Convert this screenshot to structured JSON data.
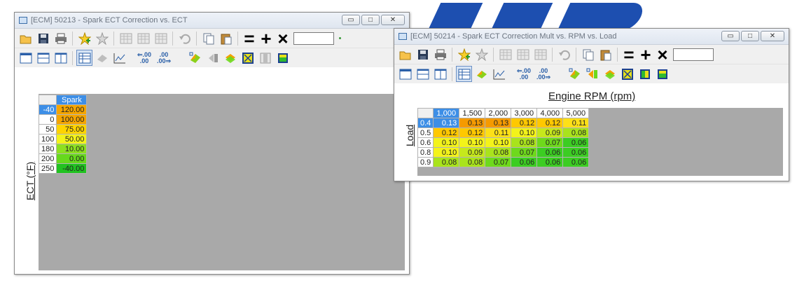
{
  "win1": {
    "title": "[ECM] 50213 - Spark ECT Correction vs. ECT",
    "value_input": "",
    "y_axis_label": "ECT (°F)",
    "column_header": "Spark",
    "rows": [
      {
        "label": "-40",
        "value": "120.00",
        "color": "#f5a500"
      },
      {
        "label": "0",
        "value": "100.00",
        "color": "#f5a500"
      },
      {
        "label": "50",
        "value": "75.00",
        "color": "#ffd400"
      },
      {
        "label": "100",
        "value": "50.00",
        "color": "#f3f31a"
      },
      {
        "label": "180",
        "value": "10.00",
        "color": "#8de020"
      },
      {
        "label": "200",
        "value": "0.00",
        "color": "#66d91c"
      },
      {
        "label": "250",
        "value": "-40.00",
        "color": "#21c221"
      }
    ]
  },
  "win2": {
    "title": "[ECM] 50214 - Spark ECT Correction Mult vs. RPM vs. Load",
    "value_input": "",
    "x_axis_label": "Engine RPM (rpm)",
    "y_axis_label": "Load",
    "columns": [
      "1,000",
      "1,500",
      "2,000",
      "3,000",
      "4,000",
      "5,000"
    ],
    "rows": [
      {
        "label": "0.4",
        "cells": [
          {
            "v": "0.13",
            "c": "#f59a00"
          },
          {
            "v": "0.13",
            "c": "#f59a00"
          },
          {
            "v": "0.13",
            "c": "#f59a00"
          },
          {
            "v": "0.12",
            "c": "#ffc800"
          },
          {
            "v": "0.12",
            "c": "#ffc800"
          },
          {
            "v": "0.11",
            "c": "#fde018"
          }
        ]
      },
      {
        "label": "0.5",
        "cells": [
          {
            "v": "0.12",
            "c": "#ffc800"
          },
          {
            "v": "0.12",
            "c": "#ffc800"
          },
          {
            "v": "0.11",
            "c": "#fde018"
          },
          {
            "v": "0.10",
            "c": "#f3f31a"
          },
          {
            "v": "0.09",
            "c": "#c6e81c"
          },
          {
            "v": "0.08",
            "c": "#a9e31c"
          }
        ]
      },
      {
        "label": "0.6",
        "cells": [
          {
            "v": "0.10",
            "c": "#f3f31a"
          },
          {
            "v": "0.10",
            "c": "#f3f31a"
          },
          {
            "v": "0.10",
            "c": "#f3f31a"
          },
          {
            "v": "0.08",
            "c": "#a9e31c"
          },
          {
            "v": "0.07",
            "c": "#6ed91c"
          },
          {
            "v": "0.06",
            "c": "#3ccd22"
          }
        ]
      },
      {
        "label": "0.8",
        "cells": [
          {
            "v": "0.10",
            "c": "#f3f31a"
          },
          {
            "v": "0.09",
            "c": "#c6e81c"
          },
          {
            "v": "0.08",
            "c": "#a9e31c"
          },
          {
            "v": "0.07",
            "c": "#6ed91c"
          },
          {
            "v": "0.06",
            "c": "#3ccd22"
          },
          {
            "v": "0.06",
            "c": "#3ccd22"
          }
        ]
      },
      {
        "label": "0.9",
        "cells": [
          {
            "v": "0.08",
            "c": "#a9e31c"
          },
          {
            "v": "0.08",
            "c": "#a9e31c"
          },
          {
            "v": "0.07",
            "c": "#6ed91c"
          },
          {
            "v": "0.06",
            "c": "#3ccd22"
          },
          {
            "v": "0.06",
            "c": "#3ccd22"
          },
          {
            "v": "0.06",
            "c": "#3ccd22"
          }
        ]
      }
    ]
  },
  "toolbar": {
    "rate_top_left": ".00",
    "rate_top_right": ".00",
    "rate_bottom_left": ".00",
    "rate_bottom_right": ".00",
    "rate_left_arrow": "⇐",
    "rate_right_arrow": "⇒"
  },
  "icons": {
    "open": "folder-open-icon",
    "save": "save-icon",
    "print": "print-icon",
    "fav_add": "favorite-add-icon",
    "fav_remove": "favorite-remove-icon",
    "set_equal": "equals-icon",
    "add": "plus-icon",
    "multiply": "multiply-icon"
  }
}
